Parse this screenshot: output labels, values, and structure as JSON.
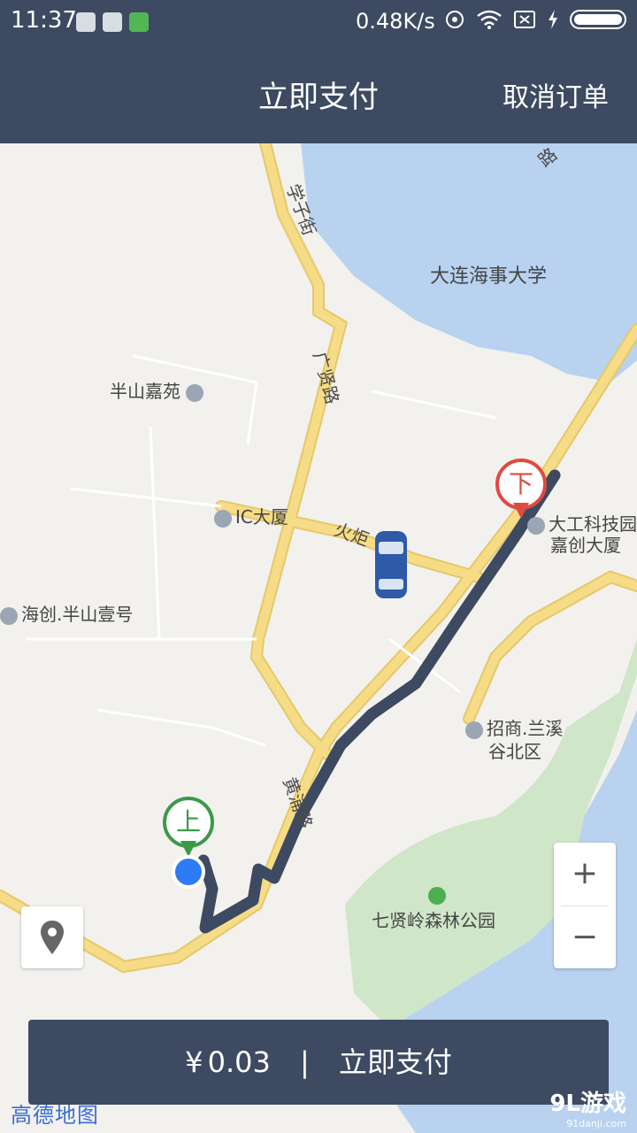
{
  "status_bar": {
    "time": "11:37",
    "speed": "0.48K/s"
  },
  "header": {
    "title": "立即支付",
    "cancel_label": "取消订单"
  },
  "map": {
    "places": {
      "university": "大连海事大学",
      "banshan": "半山嘉苑",
      "ic": "IC大厦",
      "haichuang": "海创.半山壹号",
      "dagong_1": "大工科技园",
      "dagong_2": "嘉创大厦",
      "zhaoshang_1": "招商.兰溪",
      "zhaoshang_2": "谷北区",
      "park": "七贤岭森林公园"
    },
    "roads": {
      "xuezijie": "学子街",
      "guangxianlu": "广贤路",
      "huoju": "火炬",
      "huangpulu": "黄浦路",
      "top_road": "路"
    },
    "pickup_label": "上",
    "dropoff_label": "下",
    "zoom_in": "+",
    "zoom_out": "−",
    "attribution": "高德地图"
  },
  "pay": {
    "currency": "¥",
    "amount": "0.03",
    "separator": "|",
    "action": "立即支付"
  },
  "watermark": {
    "brand": "9L游戏",
    "url": "91danji.com"
  },
  "colors": {
    "header": "#3d4a61",
    "pickup": "#3a9a48",
    "dropoff": "#e04a40",
    "route": "#3d4a61",
    "water": "#b8d2f0",
    "road": "#f6dc86"
  }
}
